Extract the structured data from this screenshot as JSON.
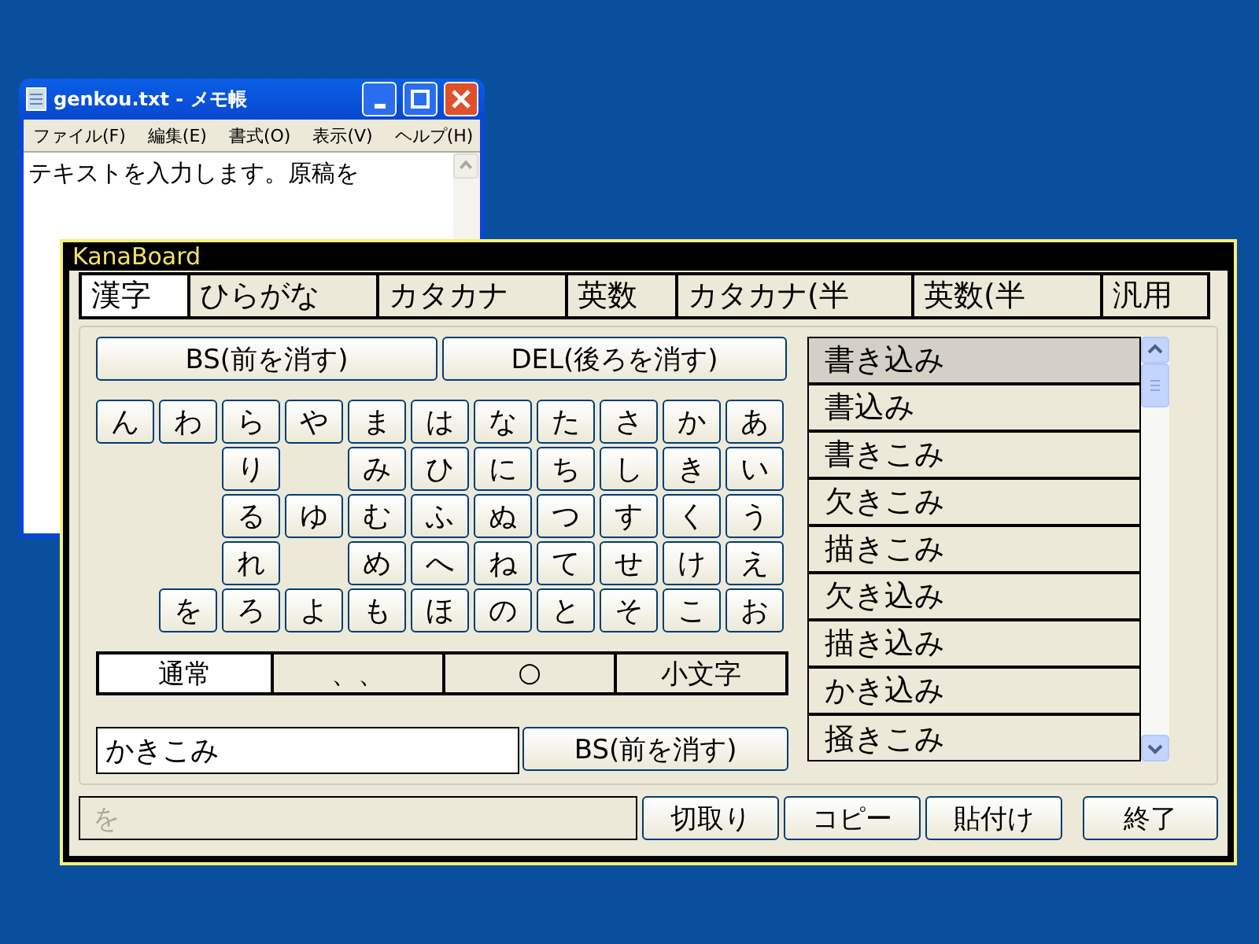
{
  "notepad": {
    "title": "genkou.txt - メモ帳",
    "menu": [
      "ファイル(F)",
      "編集(E)",
      "書式(O)",
      "表示(V)",
      "ヘルプ(H)"
    ],
    "text": "テキストを入力します。原稿を"
  },
  "kanaboard": {
    "title": "KanaBoard",
    "tabs": [
      {
        "label": "漢字",
        "selected": true
      },
      {
        "label": "ひらがな",
        "selected": false
      },
      {
        "label": "カタカナ",
        "selected": false
      },
      {
        "label": "英数",
        "selected": false
      },
      {
        "label": "カタカナ(半",
        "selected": false
      },
      {
        "label": "英数(半",
        "selected": false
      },
      {
        "label": "汎用",
        "selected": false
      }
    ],
    "edit_buttons": [
      "BS(前を消す)",
      "DEL(後ろを消す)"
    ],
    "kana_rows": [
      [
        {
          "kind": "key",
          "label": "ん"
        },
        {
          "kind": "key",
          "label": "わ"
        },
        {
          "kind": "key",
          "label": "ら"
        },
        {
          "kind": "key",
          "label": "や"
        },
        {
          "kind": "key",
          "label": "ま"
        },
        {
          "kind": "key",
          "label": "は"
        },
        {
          "kind": "key",
          "label": "な"
        },
        {
          "kind": "key",
          "label": "た"
        },
        {
          "kind": "key",
          "label": "さ"
        },
        {
          "kind": "key",
          "label": "か"
        },
        {
          "kind": "key",
          "label": "あ"
        }
      ],
      [
        {
          "kind": "blank"
        },
        {
          "kind": "blank"
        },
        {
          "kind": "key",
          "label": "り"
        },
        {
          "kind": "blank"
        },
        {
          "kind": "key",
          "label": "み"
        },
        {
          "kind": "key",
          "label": "ひ"
        },
        {
          "kind": "key",
          "label": "に"
        },
        {
          "kind": "key",
          "label": "ち"
        },
        {
          "kind": "key",
          "label": "し"
        },
        {
          "kind": "key",
          "label": "き"
        },
        {
          "kind": "key",
          "label": "い"
        }
      ],
      [
        {
          "kind": "blank"
        },
        {
          "kind": "blank"
        },
        {
          "kind": "key",
          "label": "る"
        },
        {
          "kind": "key",
          "label": "ゆ"
        },
        {
          "kind": "key",
          "label": "む"
        },
        {
          "kind": "key",
          "label": "ふ"
        },
        {
          "kind": "key",
          "label": "ぬ"
        },
        {
          "kind": "key",
          "label": "つ"
        },
        {
          "kind": "key",
          "label": "す"
        },
        {
          "kind": "key",
          "label": "く"
        },
        {
          "kind": "key",
          "label": "う"
        }
      ],
      [
        {
          "kind": "blank"
        },
        {
          "kind": "blank"
        },
        {
          "kind": "key",
          "label": "れ"
        },
        {
          "kind": "blank"
        },
        {
          "kind": "key",
          "label": "め"
        },
        {
          "kind": "key",
          "label": "へ"
        },
        {
          "kind": "key",
          "label": "ね"
        },
        {
          "kind": "key",
          "label": "て"
        },
        {
          "kind": "key",
          "label": "せ"
        },
        {
          "kind": "key",
          "label": "け"
        },
        {
          "kind": "key",
          "label": "え"
        }
      ],
      [
        {
          "kind": "blank"
        },
        {
          "kind": "key",
          "label": "を"
        },
        {
          "kind": "key",
          "label": "ろ"
        },
        {
          "kind": "key",
          "label": "よ"
        },
        {
          "kind": "key",
          "label": "も"
        },
        {
          "kind": "key",
          "label": "ほ"
        },
        {
          "kind": "key",
          "label": "の"
        },
        {
          "kind": "key",
          "label": "と"
        },
        {
          "kind": "key",
          "label": "そ"
        },
        {
          "kind": "key",
          "label": "こ"
        },
        {
          "kind": "key",
          "label": "お"
        }
      ]
    ],
    "modes": [
      {
        "label": "通常",
        "selected": true
      },
      {
        "label": "、、",
        "selected": false
      },
      {
        "label": "○",
        "selected": false
      },
      {
        "label": "小文字",
        "selected": false
      }
    ],
    "input": {
      "value": "かきこみ"
    },
    "input_button": "BS(前を消す)",
    "candidates": [
      {
        "label": "書き込み",
        "selected": true
      },
      {
        "label": "書込み",
        "selected": false
      },
      {
        "label": "書きこみ",
        "selected": false
      },
      {
        "label": "欠きこみ",
        "selected": false
      },
      {
        "label": "描きこみ",
        "selected": false
      },
      {
        "label": "欠き込み",
        "selected": false
      },
      {
        "label": "描き込み",
        "selected": false
      },
      {
        "label": "かき込み",
        "selected": false
      },
      {
        "label": "掻きこみ",
        "selected": false
      }
    ],
    "status_text": "を",
    "action_buttons": [
      "切取り",
      "コピー",
      "貼付け"
    ],
    "exit_button": "終了"
  }
}
